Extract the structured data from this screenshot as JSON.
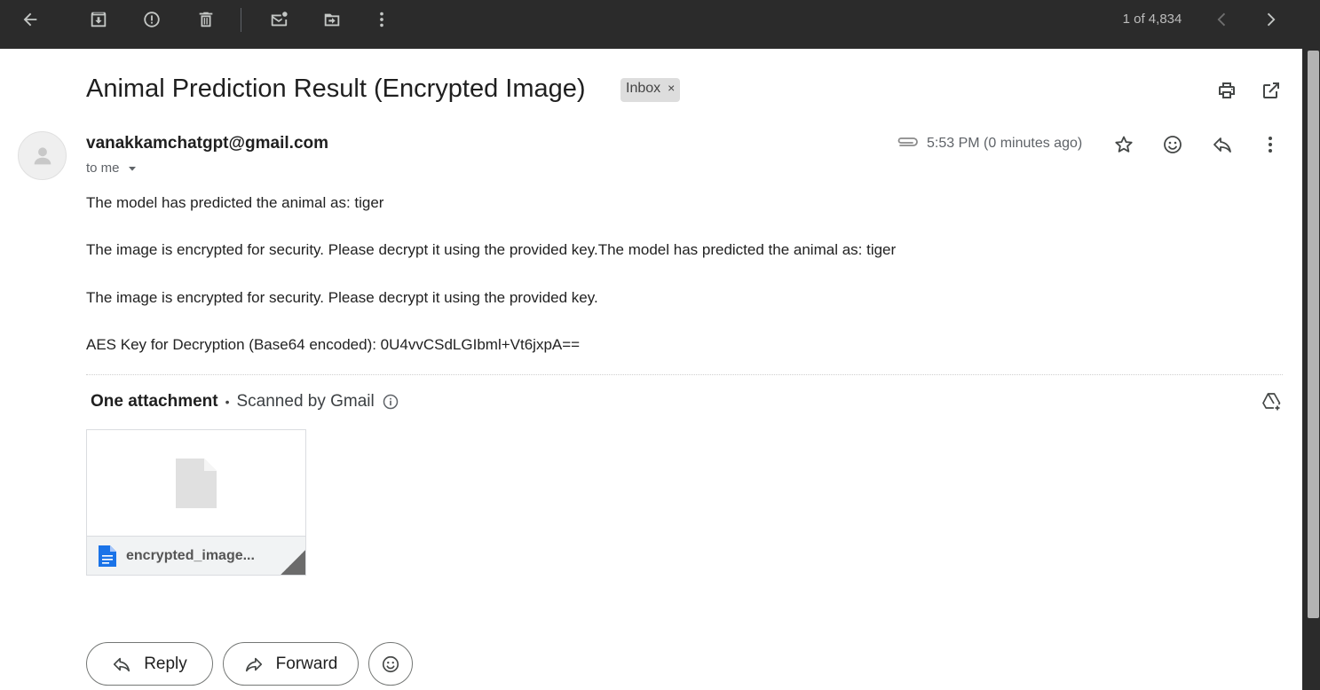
{
  "toolbar": {
    "pager_text": "1 of 4,834",
    "icons": [
      "back-arrow-icon",
      "archive-icon",
      "report-spam-icon",
      "delete-icon",
      "mark-unread-icon",
      "move-to-icon",
      "more-vert-icon",
      "prev-icon",
      "next-icon"
    ]
  },
  "email": {
    "subject": "Animal Prediction Result (Encrypted Image)",
    "label": "Inbox",
    "label_remove": "×",
    "sender": "vanakkamchatgpt@gmail.com",
    "recipient": "to me",
    "time": "5:53 PM (0 minutes ago)",
    "body": [
      "The model has predicted the animal as: tiger",
      "The image is encrypted for security. Please decrypt it using the provided key.The model has predicted the animal as: tiger",
      "The image is encrypted for security. Please decrypt it using the provided key.",
      "AES Key for Decryption (Base64 encoded): 0U4vvCSdLGIbml+Vt6jxpA=="
    ]
  },
  "attachments": {
    "heading": "One attachment",
    "separator": "•",
    "scanned": "Scanned by Gmail",
    "file_name": "encrypted_image..."
  },
  "actions": {
    "reply": "Reply",
    "forward": "Forward"
  },
  "colors": {
    "toolbar_bg": "#2b2b2b",
    "file_icon": "#1a73e8",
    "chip_bg": "#dddddd"
  }
}
